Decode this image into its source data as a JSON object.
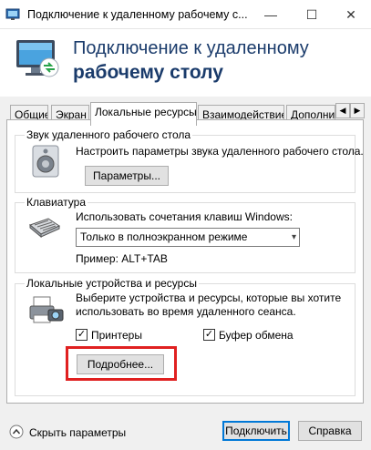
{
  "window": {
    "title": "Подключение к удаленному рабочему с...",
    "minimize_glyph": "—",
    "maximize_glyph": "☐",
    "close_glyph": "✕"
  },
  "banner": {
    "line1": "Подключение к удаленному",
    "line2": "рабочему столу"
  },
  "tabs": [
    {
      "label": "Общие"
    },
    {
      "label": "Экран"
    },
    {
      "label": "Локальные ресурсы",
      "active": true
    },
    {
      "label": "Взаимодействие"
    },
    {
      "label": "Дополни"
    }
  ],
  "tab_scroll": {
    "left": "◀",
    "right": "▶"
  },
  "audio": {
    "group_label": "Звук удаленного рабочего стола",
    "description": "Настроить параметры звука удаленного рабочего стола.",
    "button": "Параметры..."
  },
  "keyboard": {
    "group_label": "Клавиатура",
    "description": "Использовать сочетания клавиш Windows:",
    "selected": "Только в полноэкранном режиме",
    "dropdown_arrow": "▾",
    "example": "Пример: ALT+TAB"
  },
  "devices": {
    "group_label": "Локальные устройства и ресурсы",
    "description_line1": "Выберите устройства и ресурсы, которые вы хотите",
    "description_line2": "использовать во время удаленного сеанса.",
    "printers_label": "Принтеры",
    "printers_checked": true,
    "clipboard_label": "Буфер обмена",
    "clipboard_checked": true,
    "check_glyph": "✓",
    "more_button": "Подробнее..."
  },
  "footer": {
    "toggle_label": "Скрыть параметры",
    "connect_button": "Подключить",
    "help_button": "Справка"
  },
  "colors": {
    "banner_text": "#1a3b6b",
    "highlight": "#e02020",
    "default_button_border": "#0078d7"
  }
}
